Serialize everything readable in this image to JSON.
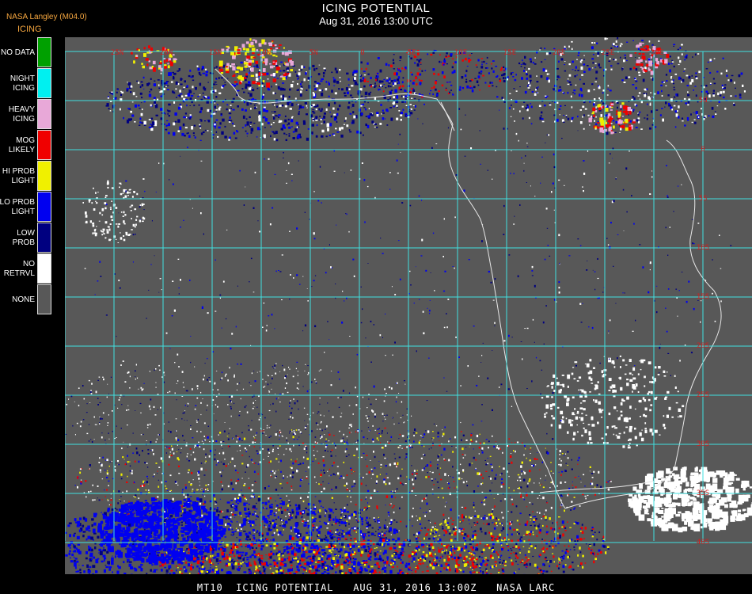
{
  "header": {
    "title": "ICING POTENTIAL",
    "datetime": "Aug 31, 2016 13:00 UTC",
    "source": "NASA Langley (M04.0)",
    "legend_title": "ICING"
  },
  "legend": [
    {
      "label": "NO DATA",
      "color": "#00a000"
    },
    {
      "label": "NIGHT\nICING",
      "color": "#00f0f0"
    },
    {
      "label": "HEAVY\nICING",
      "color": "#e8a8d8"
    },
    {
      "label": "MOG\nLIKELY",
      "color": "#f00000"
    },
    {
      "label": "HI PROB\nLIGHT",
      "color": "#f0f000"
    },
    {
      "label": "LO PROB\nLIGHT",
      "color": "#0000f0"
    },
    {
      "label": "LOW\nPROB",
      "color": "#000080"
    },
    {
      "label": "NO\nRETRVL",
      "color": "#ffffff"
    },
    {
      "label": "NONE",
      "color": "#585858"
    }
  ],
  "map": {
    "grid_color": "#40e0e0",
    "top_labels": [
      "25N",
      "20N",
      "15N",
      "10N",
      "5N",
      "0",
      "5E",
      "10E",
      "15E",
      "20E",
      "25E",
      "30E"
    ],
    "right_labels": [
      "5N",
      "0",
      "5S",
      "10S",
      "15S",
      "20S",
      "25S",
      "30S",
      "35S",
      "40S"
    ]
  },
  "footer": "MT10  ICING POTENTIAL   AUG 31, 2016 13:00Z   NASA LARC"
}
